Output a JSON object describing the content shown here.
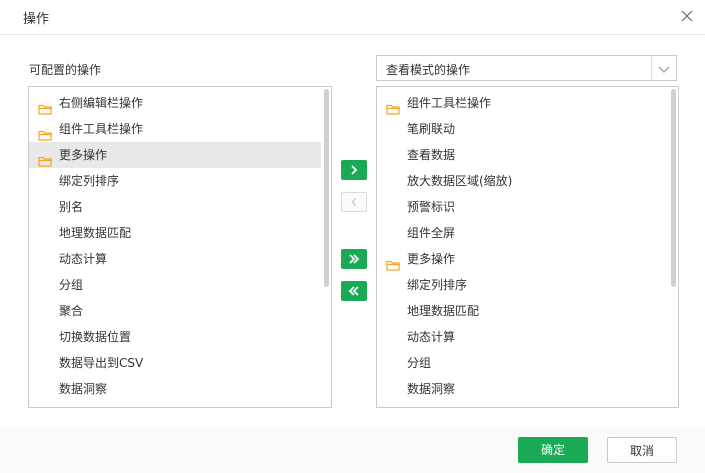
{
  "dialog": {
    "title": "操作",
    "configurable_label": "可配置的操作",
    "mode_select": {
      "value": "查看模式的操作"
    },
    "buttons": {
      "ok": "确定",
      "cancel": "取消"
    },
    "transfer_buttons": {
      "move_right": {
        "icon": "chevron-right-icon",
        "glyph": "›"
      },
      "move_left": {
        "icon": "chevron-left-icon",
        "glyph": "‹"
      },
      "move_all_right": {
        "icon": "double-chevron-right-icon",
        "glyph": "»"
      },
      "move_all_left": {
        "icon": "double-chevron-left-icon",
        "glyph": "«"
      }
    },
    "colors": {
      "accent": "#1aaa55",
      "folder": "#f5a623",
      "selected_bg": "#e8e8e8"
    }
  },
  "left_list": [
    {
      "type": "folder",
      "label": "右侧编辑栏操作"
    },
    {
      "type": "folder",
      "label": "组件工具栏操作"
    },
    {
      "type": "folder",
      "label": "更多操作",
      "selected": true
    },
    {
      "type": "child",
      "label": "绑定列排序"
    },
    {
      "type": "child",
      "label": "别名"
    },
    {
      "type": "child",
      "label": "地理数据匹配"
    },
    {
      "type": "child",
      "label": "动态计算"
    },
    {
      "type": "child",
      "label": "分组"
    },
    {
      "type": "child",
      "label": "聚合"
    },
    {
      "type": "child",
      "label": "切换数据位置"
    },
    {
      "type": "child",
      "label": "数据导出到CSV"
    },
    {
      "type": "child",
      "label": "数据洞察"
    }
  ],
  "right_list": [
    {
      "type": "folder",
      "label": "组件工具栏操作"
    },
    {
      "type": "child",
      "label": "笔刷联动"
    },
    {
      "type": "child",
      "label": "查看数据"
    },
    {
      "type": "child",
      "label": "放大数据区域(缩放)"
    },
    {
      "type": "child",
      "label": "预警标识"
    },
    {
      "type": "child",
      "label": "组件全屏"
    },
    {
      "type": "folder",
      "label": "更多操作"
    },
    {
      "type": "child",
      "label": "绑定列排序"
    },
    {
      "type": "child",
      "label": "地理数据匹配"
    },
    {
      "type": "child",
      "label": "动态计算"
    },
    {
      "type": "child",
      "label": "分组"
    },
    {
      "type": "child",
      "label": "数据洞察"
    }
  ]
}
